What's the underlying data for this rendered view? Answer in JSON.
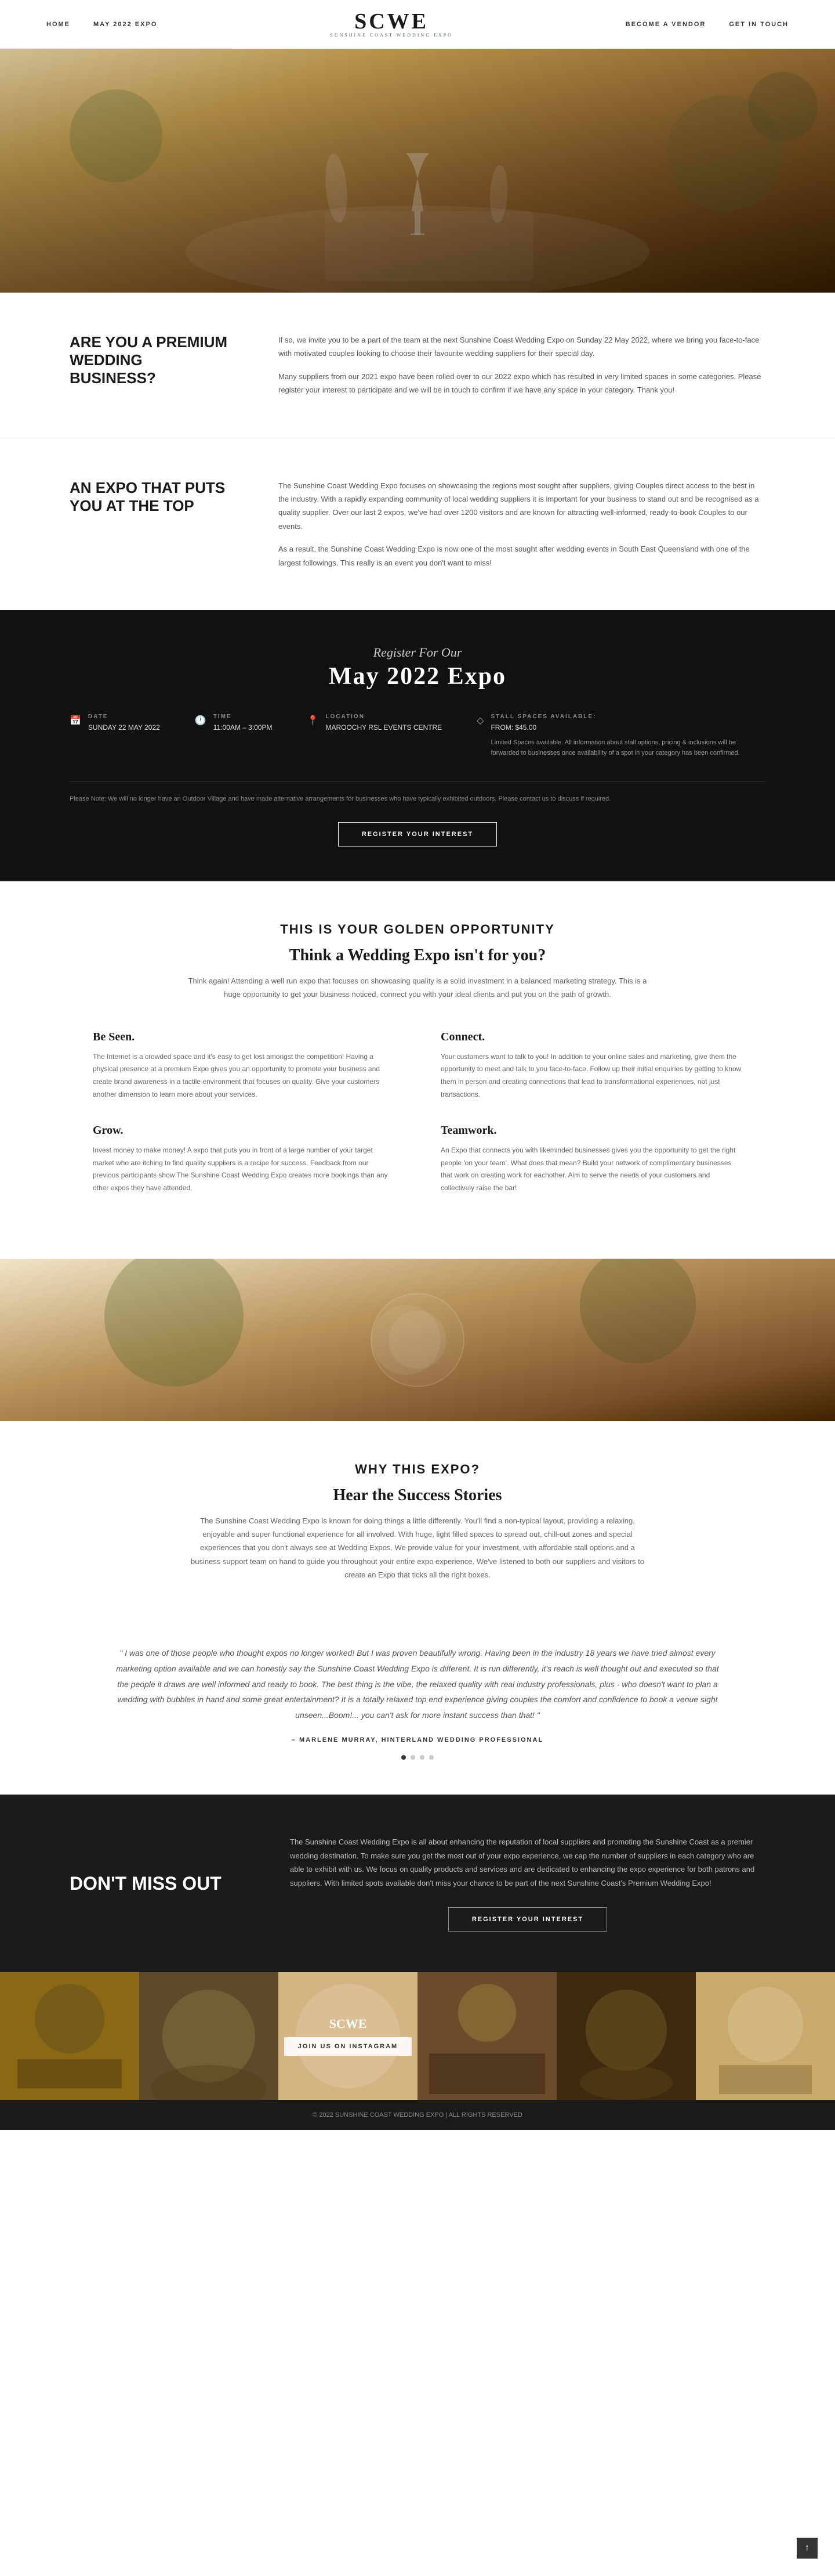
{
  "nav": {
    "links_left": [
      "HOME",
      "MAY 2022 EXPO"
    ],
    "logo": "SCWE",
    "logo_sub": "SUNSHINE COAST WEDDING EXPO",
    "links_right": [
      "BECOME A VENDOR",
      "GET IN TOUCH"
    ]
  },
  "hero": {
    "alt": "Wedding outdoor setting with champagne glasses and flowers"
  },
  "section1": {
    "heading": "ARE YOU A PREMIUM WEDDING BUSINESS?",
    "para1": "If so, we invite you to be a part of the team at the next Sunshine Coast Wedding Expo on Sunday 22 May 2022, where we bring you face-to-face with motivated couples looking to choose their favourite wedding suppliers for their special day.",
    "para2": "Many suppliers from our 2021 expo have been rolled over to our 2022 expo which has resulted in very limited spaces in some categories. Please register your interest to participate and we will be in touch to confirm if we have any space in your category. Thank you!"
  },
  "section2": {
    "heading": "AN EXPO THAT PUTS YOU AT THE TOP",
    "para1": "The Sunshine Coast Wedding Expo focuses on showcasing the regions most sought after suppliers, giving Couples direct access to the best in the industry. With a rapidly expanding community of local wedding suppliers it is important for your business to stand out and be recognised as a quality supplier. Over our last 2 expos, we've had over 1200 visitors and are known for attracting well-informed, ready-to-book Couples to our events.",
    "para2": "As a result, the Sunshine Coast Wedding Expo is now one of the most sought after wedding events in South East Queensland with one of the largest followings. This really is an event you don't want to miss!"
  },
  "expo": {
    "script_text": "Register For Our",
    "title": "May 2022 Expo",
    "date_label": "DATE",
    "date_value": "SUNDAY 22 MAY 2022",
    "time_label": "TIME",
    "time_value": "11:00AM – 3:00PM",
    "location_label": "LOCATION",
    "location_value": "MAROOCHY RSL EVENTS CENTRE",
    "stall_label": "STALL SPACES AVAILABLE:",
    "stall_price": "FROM: $45.00",
    "stall_note": "Limited Spaces available. All information about stall options, pricing & inclusions will be forwarded to businesses once availability of a spot in your category has been confirmed.",
    "note": "Please Note: We will no longer have an Outdoor Village and have made alternative arrangements for businesses who have typically exhibited outdoors. Please contact us to discuss if required.",
    "register_btn": "REGISTER YOUR INTEREST"
  },
  "golden": {
    "main_title": "THIS IS YOUR GOLDEN OPPORTUNITY",
    "subtitle": "Think a Wedding Expo isn't for you?",
    "intro": "Think again! Attending a well run expo that focuses on showcasing quality is a solid investment in a balanced marketing strategy. This is a huge opportunity to get your business noticed, connect you with your ideal clients and put you on the path of growth.",
    "features": [
      {
        "title": "Be Seen.",
        "text": "The Internet is a crowded space and it's easy to get lost amongst the competition! Having a physical presence at a premium Expo gives you an opportunity to promote your business and create brand awareness in a tactile environment that focuses on quality. Give your customers another dimension to learn more about your services."
      },
      {
        "title": "Connect.",
        "text": "Your customers want to talk to you! In addition to your online sales and marketing, give them the opportunity to meet and talk to you face-to-face. Follow up their initial enquiries by getting to know them in person and creating connections that lead to transformational experiences, not just transactions."
      },
      {
        "title": "Grow.",
        "text": "Invest money to make money! A expo that puts you in front of a large number of your target market who are itching to find quality suppliers is a recipe for success. Feedback from our previous participants show The Sunshine Coast Wedding Expo creates more bookings than any other expos they have attended."
      },
      {
        "title": "Teamwork.",
        "text": "An Expo that connects you with likeminded businesses gives you the opportunity to get the right people 'on your team'. What does that mean? Build your network of complimentary businesses that work on creating work for eachother. Aim to serve the needs of your customers and collectively raise the bar!"
      }
    ]
  },
  "why": {
    "main_title": "WHY THIS EXPO?",
    "subtitle": "Hear the Success Stories",
    "intro": "The Sunshine Coast Wedding Expo is known for doing things a little differently. You'll find a non-typical layout, providing a relaxing, enjoyable and super functional experience for all involved. With huge, light filled spaces to spread out, chill-out zones and special experiences that you don't always see at Wedding Expos. We provide value for your investment, with affordable stall options and a business support team on hand to guide you throughout your entire expo experience. We've listened to both our suppliers and visitors to create an Expo that ticks all the right boxes."
  },
  "testimonial": {
    "quote": "\" I was one of those people who thought expos no longer worked! But I was proven beautifully wrong. Having been in the industry 18 years we have tried almost every marketing option available and we can honestly say the Sunshine Coast Wedding Expo is different. It is run differently, it's reach is well thought out and executed so that the people it draws are well informed and ready to book. The best thing is the vibe, the relaxed quality with real industry professionals, plus - who doesn't want to plan a wedding with bubbles in hand and some great entertainment? It is a totally relaxed top end experience giving couples the comfort and confidence to book a venue sight unseen...Boom!... you can't ask for more instant success than that! \"",
    "author": "– MARLENE MURRAY, HINTERLAND WEDDING PROFESSIONAL",
    "dots": [
      "active",
      "",
      "",
      ""
    ]
  },
  "dont_miss": {
    "heading": "DON'T MISS OUT",
    "text": "The Sunshine Coast Wedding Expo is all about enhancing the reputation of local suppliers and promoting the Sunshine Coast as a premier wedding destination. To make sure you get the most out of your expo experience, we cap the number of suppliers in each category who are able to exhibit with us. We focus on quality products and services and are dedicated to enhancing the expo experience for both patrons and suppliers. With limited spots available don't miss your chance to be part of the next Sunshine Coast's Premium Wedding Expo!",
    "register_btn": "REGISTER YOUR INTEREST"
  },
  "instagram": {
    "btn": "JOIN US ON INSTAGRAM",
    "logo": "SCWE"
  },
  "footer": {
    "text": "© 2022 SUNSHINE COAST WEDDING EXPO | ALL RIGHTS RESERVED"
  }
}
